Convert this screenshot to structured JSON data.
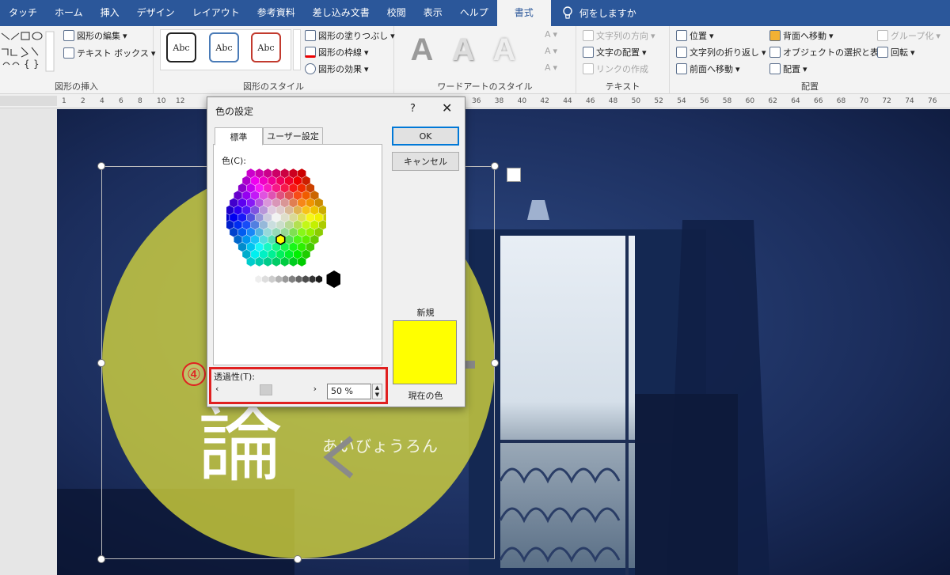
{
  "ribbon_tabs": [
    "タッチ",
    "ホーム",
    "挿入",
    "デザイン",
    "レイアウト",
    "参考資料",
    "差し込み文書",
    "校閲",
    "表示",
    "ヘルプ",
    "書式"
  ],
  "active_tab": "書式",
  "tell_me": "何をしますか",
  "groups": {
    "insert_shapes": {
      "label": "図形の挿入",
      "edit_shape": "図形の編集",
      "text_box": "テキスト ボックス"
    },
    "shape_styles": {
      "label": "図形のスタイル",
      "style_sample": "Abc",
      "fill": "図形の塗りつぶし",
      "outline": "図形の枠線",
      "effects": "図形の効果"
    },
    "wordart": {
      "label": "ワードアートのスタイル",
      "letter": "A"
    },
    "text": {
      "label": "テキスト",
      "direction": "文字列の方向",
      "align": "文字の配置",
      "link": "リンクの作成"
    },
    "arrange": {
      "label": "配置",
      "position": "位置",
      "wrap": "文字列の折り返し",
      "forward": "前面へ移動",
      "backward": "背面へ移動",
      "selection": "オブジェクトの選択と表示",
      "align": "配置",
      "group": "グループ化",
      "rotate": "回転"
    }
  },
  "ruler": {
    "left_ticks": [
      "1",
      "2",
      "4",
      "6",
      "8",
      "10",
      "12"
    ],
    "right_ticks": [
      "36",
      "38",
      "40",
      "42",
      "44",
      "46",
      "48",
      "50",
      "52",
      "54",
      "56",
      "58",
      "60",
      "62",
      "64",
      "66",
      "68",
      "70",
      "72",
      "74",
      "76"
    ]
  },
  "document": {
    "big_char": "論",
    "reading": "あいびょうろん",
    "step_number": "④"
  },
  "colors": {
    "ribbon": "#2b579a",
    "highlight": "#e02020",
    "selected": "#ffff00",
    "circle": "#e8e63a"
  },
  "dialog": {
    "title": "色の設定",
    "help": "?",
    "close": "✕",
    "tab_standard": "標準",
    "tab_custom": "ユーザー設定",
    "color_label": "色(C):",
    "ok": "OK",
    "cancel": "キャンセル",
    "new_label": "新規",
    "current_label": "現在の色",
    "transparency_label": "透過性(T):",
    "transparency_value": "50 %",
    "transparency_fraction": 0.5
  }
}
